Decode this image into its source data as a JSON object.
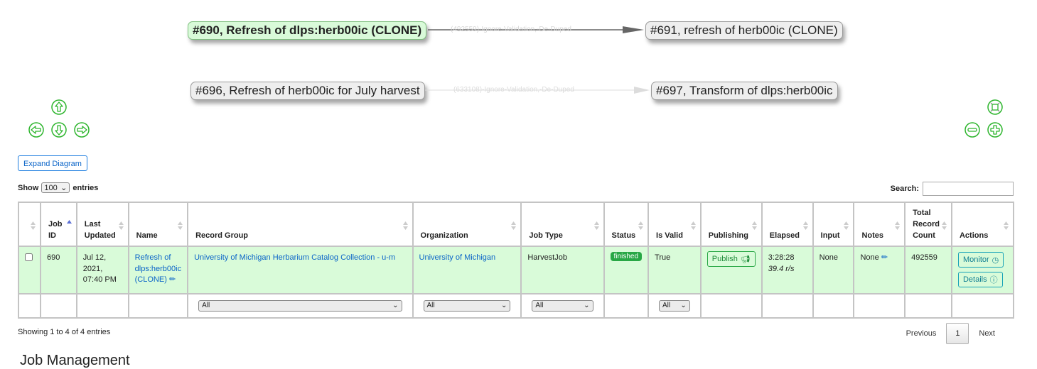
{
  "diagram": {
    "nodes": [
      {
        "label": "#690, Refresh of dlps:herb00ic (CLONE)",
        "active": true
      },
      {
        "label": "#691, refresh of herb00ic (CLONE)",
        "active": false
      },
      {
        "label": "#696, Refresh of herb00ic for July harvest",
        "active": false
      },
      {
        "label": "#697, Transform of dlps:herb00ic",
        "active": false
      }
    ],
    "edges": [
      {
        "label": "(492559)-Ignore-Validation,-De-Duped"
      },
      {
        "label": "(633108)-Ignore-Validation,-De-Duped"
      }
    ],
    "controls": {
      "pan_up": "arrow-up",
      "pan_down": "arrow-down",
      "pan_left": "arrow-left",
      "pan_right": "arrow-right",
      "fit": "fit-screen",
      "zoom_out": "minus",
      "zoom_in": "plus"
    }
  },
  "expand_diagram_label": "Expand Diagram",
  "length": {
    "show_label": "Show",
    "value": "100",
    "entries_label": "entries"
  },
  "search": {
    "label": "Search:",
    "value": "",
    "placeholder": ""
  },
  "table": {
    "columns": [
      "",
      "Job ID",
      "Last Updated",
      "Name",
      "Record Group",
      "Organization",
      "Job Type",
      "Status",
      "Is Valid",
      "Publishing",
      "Elapsed",
      "Input",
      "Notes",
      "Total Record Count",
      "Actions"
    ],
    "sorted_column": "Job ID",
    "rows": [
      {
        "checked": false,
        "job_id": "690",
        "last_updated": "Jul 12, 2021, 07:40 PM",
        "name": "Refresh of dlps:herb00ic (CLONE)",
        "record_group": "University of Michigan Herbarium Catalog Collection - u-m",
        "organization": "University of Michigan",
        "job_type": "HarvestJob",
        "status": "finished",
        "is_valid": "True",
        "publishing": "Publish",
        "elapsed": "3:28:28",
        "rate": "39.4 r/s",
        "input": "None",
        "notes": "None",
        "total_record_count": "492559",
        "actions": [
          "Monitor",
          "Details"
        ]
      }
    ],
    "filters": {
      "record_group": "All",
      "organization": "All",
      "job_type": "All",
      "is_valid": "All"
    }
  },
  "info": "Showing 1 to 4 of 4 entries",
  "pagination": {
    "previous": "Previous",
    "current": "1",
    "next": "Next"
  },
  "section_title": "Job Management",
  "colors": {
    "active_row": "#d9fbd9",
    "link": "#0a64c8",
    "success": "#28a745",
    "info": "#17a2b8",
    "nav_green": "#2db52d"
  }
}
